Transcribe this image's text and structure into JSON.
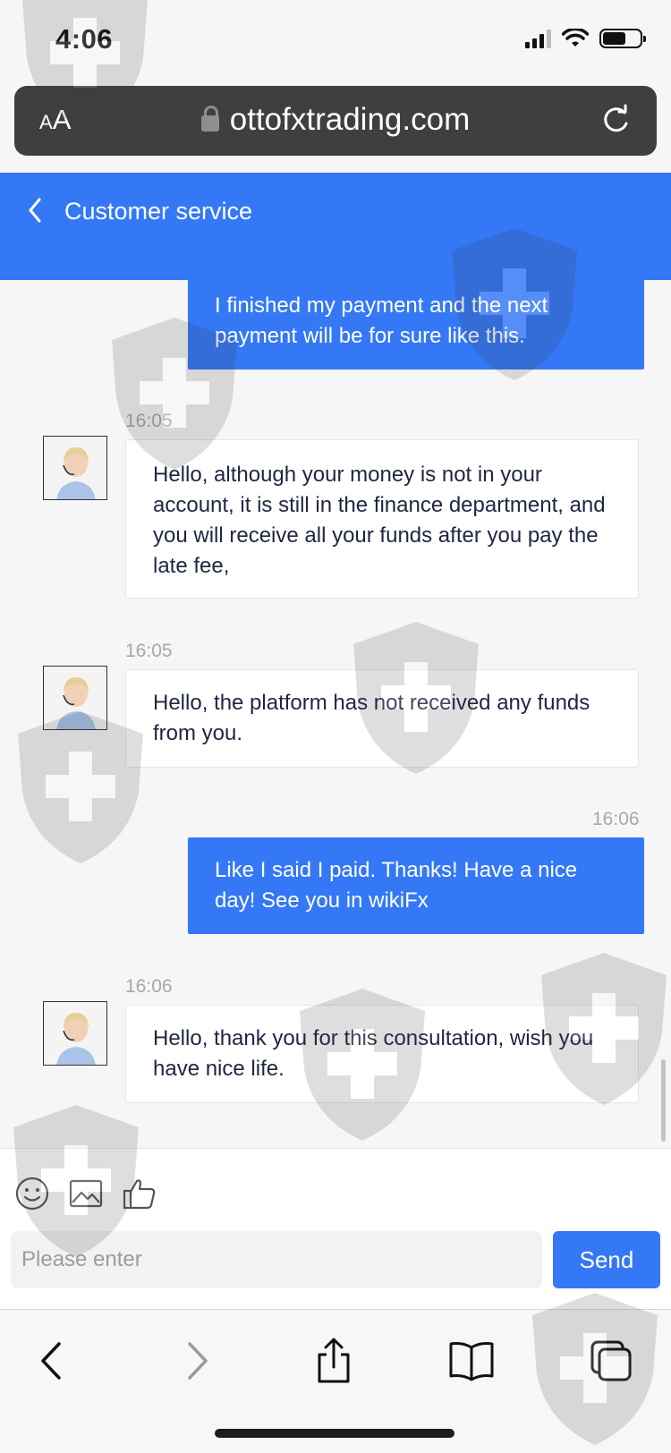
{
  "status_bar": {
    "time": "4:06"
  },
  "browser": {
    "text_size_small": "A",
    "text_size_large": "A",
    "url": "ottofxtrading.com"
  },
  "header": {
    "title": "Customer service"
  },
  "messages": [
    {
      "sender": "user",
      "time": "",
      "text": "I finished my payment and the next payment will be for sure like this."
    },
    {
      "sender": "agent",
      "time": "16:05",
      "text": "Hello, although your money is not in your account, it is still in the finance department, and you will receive all your funds after you pay the late fee,"
    },
    {
      "sender": "agent",
      "time": "16:05",
      "text": "Hello, the platform has not received any funds from you."
    },
    {
      "sender": "user",
      "time": "16:06",
      "text": "Like I said I paid. Thanks! Have a nice day! See you in wikiFx"
    },
    {
      "sender": "agent",
      "time": "16:06",
      "text": "Hello, thank you for this consultation, wish you have nice life."
    }
  ],
  "composer": {
    "placeholder": "Please enter",
    "send_label": "Send"
  },
  "colors": {
    "accent": "#3478f6",
    "background": "#f6f6f6"
  }
}
